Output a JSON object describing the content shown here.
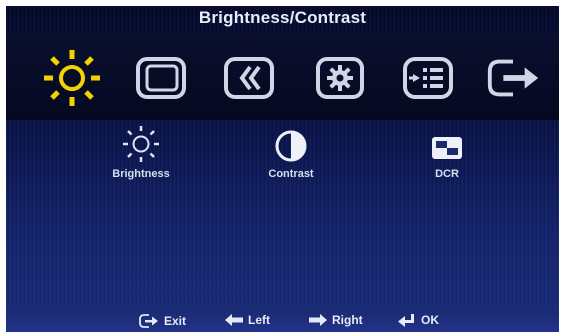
{
  "osd": {
    "title": "Brightness/Contrast",
    "tabs": [
      {
        "icon": "sun-icon",
        "selected": true
      },
      {
        "icon": "image-position-icon",
        "selected": false
      },
      {
        "icon": "image-properties-icon",
        "selected": false
      },
      {
        "icon": "options-gear-icon",
        "selected": false
      },
      {
        "icon": "input-source-icon",
        "selected": false
      },
      {
        "icon": "exit-icon",
        "selected": false
      }
    ],
    "items": [
      {
        "label": "Brightness",
        "icon": "sun-outline-icon"
      },
      {
        "label": "Contrast",
        "icon": "half-circle-icon"
      },
      {
        "label": "DCR",
        "icon": "dcr-icon"
      }
    ],
    "footer": {
      "exit": "Exit",
      "left": "Left",
      "right": "Right",
      "ok": "OK"
    }
  },
  "colors": {
    "accent": "#f2d400",
    "icon": "#cfd6e6",
    "panel_top": "#050a2a",
    "panel_bottom": "#1a2c78",
    "footer": "#22338a"
  }
}
